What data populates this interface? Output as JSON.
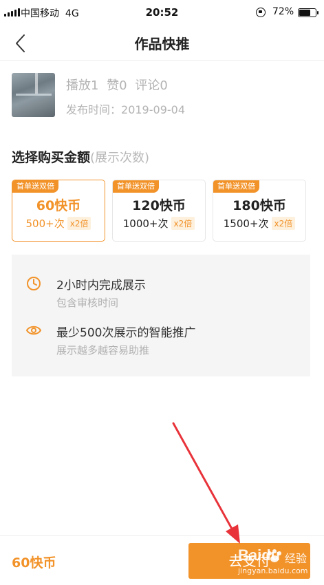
{
  "status_bar": {
    "carrier": "中国移动",
    "network": "4G",
    "time": "20:52",
    "battery": "72%",
    "battery_level": 0.72
  },
  "nav": {
    "back_icon": "chevron-left-icon",
    "title": "作品快推"
  },
  "work": {
    "plays": "播放1",
    "likes": "赞0",
    "comments": "评论0",
    "publish_label": "发布时间：",
    "publish_date": "2019-09-04"
  },
  "purchase": {
    "title": "选择购买金额",
    "subtitle": "(展示次数)",
    "options": [
      {
        "badge": "首单送双倍",
        "coins": "60快币",
        "count": "500+次",
        "multiplier": "x2倍",
        "selected": true
      },
      {
        "badge": "首单送双倍",
        "coins": "120快币",
        "count": "1000+次",
        "multiplier": "x2倍",
        "selected": false
      },
      {
        "badge": "首单送双倍",
        "coins": "180快币",
        "count": "1500+次",
        "multiplier": "x2倍",
        "selected": false
      }
    ]
  },
  "info": [
    {
      "icon": "clock-icon",
      "title": "2小时内完成展示",
      "sub": "包含审核时间"
    },
    {
      "icon": "eye-icon",
      "title": "最少500次展示的智能推广",
      "sub": "展示越多越容易助推"
    }
  ],
  "bottom": {
    "total": "60快币",
    "pay_label": "去支付"
  },
  "watermark": {
    "logo": "Baidu",
    "text": "经验",
    "url": "jingyan.baidu.com"
  },
  "colors": {
    "accent": "#f2932a",
    "annotation_arrow": "#e8333a"
  }
}
